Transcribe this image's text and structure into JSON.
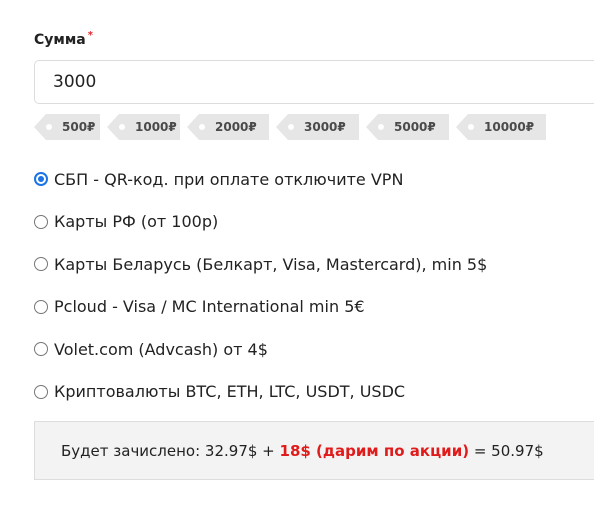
{
  "amount": {
    "label": "Сумма",
    "required_mark": "*",
    "value": "3000"
  },
  "presets": [
    "500₽",
    "1000₽",
    "2000₽",
    "3000₽",
    "5000₽",
    "10000₽"
  ],
  "payment_methods": [
    {
      "label": "СБП - QR-код. при оплате отключите VPN",
      "checked": true
    },
    {
      "label": "Карты РФ (от 100р)",
      "checked": false
    },
    {
      "label": "Карты Беларусь (Белкарт, Visa, Mastercard), min 5$",
      "checked": false
    },
    {
      "label": "Pcloud - Visa / MC International min 5€",
      "checked": false
    },
    {
      "label": "Volet.com (Advcash) от 4$",
      "checked": false
    },
    {
      "label": "Криптовалюты BTC, ETH, LTC, USDT, USDC",
      "checked": false
    }
  ],
  "summary": {
    "prefix": "Будет зачислено: 32.97$ + ",
    "bonus": "18$ (дарим по акции)",
    "suffix": " = 50.97$"
  },
  "colors": {
    "accent": "#1a73e8",
    "bonus": "#e01b1b",
    "required": "#e0282e",
    "chip_bg": "#e6e6e6",
    "summary_bg": "#f3f3f3"
  }
}
